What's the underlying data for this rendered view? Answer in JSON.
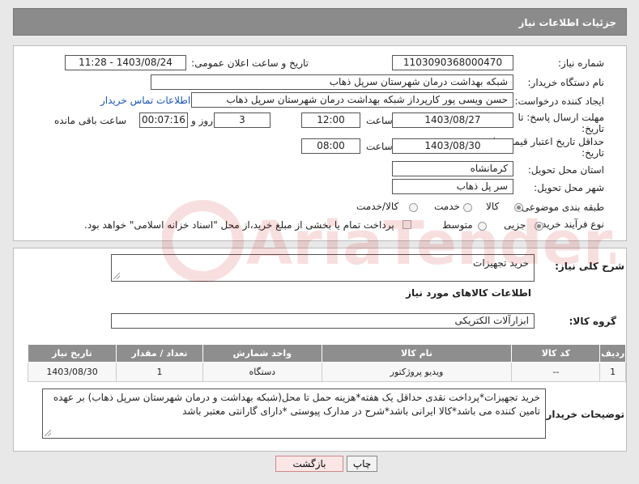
{
  "header": {
    "title": "جزئیات اطلاعات نیاز"
  },
  "form": {
    "need_number_label": "شماره نیاز:",
    "need_number": "1103090368000470",
    "announce_label": "تاریخ و ساعت اعلان عمومی:",
    "announce_value": "1403/08/24 - 11:28",
    "buyer_org_label": "نام دستگاه خریدار:",
    "buyer_org": "شبکه بهداشت درمان شهرستان سرپل ذهاب",
    "creator_label": "ایجاد کننده درخواست:",
    "creator": "حسن ویسی پور کارپرداز شبکه بهداشت درمان شهرستان سرپل ذهاب",
    "contact_link": "اطلاعات تماس خریدار",
    "reply_deadline_label": "مهلت ارسال پاسخ: تا",
    "reply_deadline_label2": "تاریخ:",
    "reply_date": "1403/08/27",
    "time_label": "ساعت",
    "reply_time": "12:00",
    "days_value": "3",
    "days_label": "روز و",
    "remaining_time": "00:07:16",
    "remaining_label": "ساعت باقی مانده",
    "validity_label": "حداقل تاریخ اعتبار قیمت: تا",
    "validity_label2": "تاریخ:",
    "validity_date": "1403/08/30",
    "validity_time_label": "ساعت",
    "validity_time": "08:00",
    "province_label": "استان محل تحویل:",
    "province": "کرمانشاه",
    "city_label": "شهر محل تحویل:",
    "city": "سر پل ذهاب",
    "category_label": "طبقه بندی موضوعی:",
    "category_options": [
      "کالا",
      "خدمت",
      "کالا/خدمت"
    ],
    "process_label": "نوع فرآیند خرید :",
    "process_options": [
      "جزیی",
      "متوسط"
    ],
    "payment_note": "پرداخت تمام یا بخشی از مبلغ خرید،از محل \"اسناد خزانه اسلامی\" خواهد بود."
  },
  "details": {
    "general_desc_label": "شرح کلی نیاز:",
    "general_desc": "خرید تجهیزات",
    "goods_info_title": "اطلاعات کالاهای مورد نیاز",
    "goods_group_label": "گروه کالا:",
    "goods_group": "ابزارآلات الکتریکی",
    "table": {
      "headers": [
        "ردیف",
        "کد کالا",
        "نام کالا",
        "واحد شمارش",
        "تعداد / مقدار",
        "تاریخ نیاز"
      ],
      "rows": [
        [
          "1",
          "--",
          "ویدیو پروژکتور",
          "دستگاه",
          "1",
          "1403/08/30"
        ]
      ]
    },
    "buyer_notes_label": "توضیحات خریدار:",
    "buyer_notes": "خرید تجهیزات*پرداخت نقدی حداقل یک هفته*هزینه حمل تا محل(شبکه بهداشت و درمان شهرستان سرپل ذهاب) بر عهده تامین کننده می باشد*کالا ایرانی باشد*شرح در مدارک پیوستی *دارای گارانتی معتبر باشد"
  },
  "buttons": {
    "print": "چاپ",
    "back": "بازگشت"
  },
  "watermark": {
    "text": "AriaTender.neT"
  }
}
